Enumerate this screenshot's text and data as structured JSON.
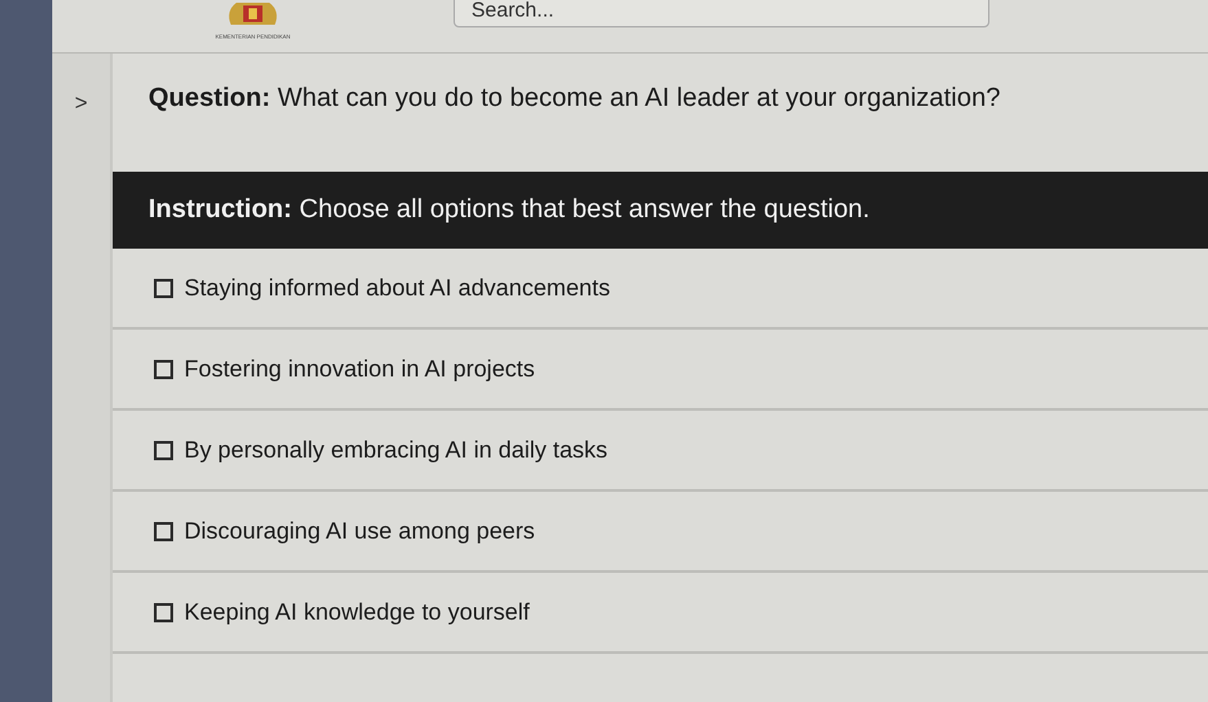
{
  "header": {
    "logo_caption": "KEMENTERIAN PENDIDIKAN",
    "search": {
      "placeholder": "Search..."
    }
  },
  "sidebar": {
    "toggle": ">"
  },
  "question": {
    "label": "Question:",
    "text": "What can you do to become an AI leader at your organization?"
  },
  "instruction": {
    "label": "Instruction:",
    "text": "Choose all options that best answer the question."
  },
  "options": [
    {
      "label": "Staying informed about AI advancements",
      "checked": false
    },
    {
      "label": "Fostering innovation in AI projects",
      "checked": false
    },
    {
      "label": "By personally embracing AI in daily tasks",
      "checked": false
    },
    {
      "label": "Discouraging AI use among peers",
      "checked": false
    },
    {
      "label": "Keeping AI knowledge to yourself",
      "checked": false
    }
  ]
}
